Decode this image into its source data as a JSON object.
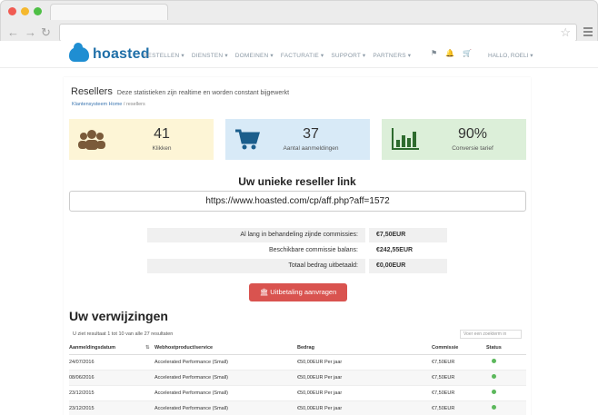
{
  "browser": {
    "back_icon": "arrow-left-icon",
    "forward_icon": "arrow-right-icon",
    "reload_icon": "reload-icon"
  },
  "site": {
    "logo_text": "hoasted",
    "menu": [
      "BESTELLEN ▾",
      "DIENSTEN ▾",
      "DOMEINEN ▾",
      "FACTURATIE ▾",
      "SUPPORT ▾",
      "PARTNERS ▾"
    ],
    "user": "HALLO, ROELI ▾"
  },
  "page": {
    "title": "Resellers",
    "subtitle": "Deze statistieken zijn realtime en worden constant bijgewerkt",
    "breadcrumb_home": "Klantensysteem Home",
    "breadcrumb_sep": "/",
    "breadcrumb_current": "resellers"
  },
  "stats": [
    {
      "value": "41",
      "label": "Klikken",
      "bg": "#fdf5d6",
      "icon": "users-icon"
    },
    {
      "value": "37",
      "label": "Aantal aanmeldingen",
      "bg": "#d8eaf7",
      "icon": "cart-icon"
    },
    {
      "value": "90%",
      "label": "Conversie tarief",
      "bg": "#dcefd9",
      "icon": "bar-chart-icon"
    }
  ],
  "link": {
    "title": "Uw unieke reseller link",
    "url": "https://www.hoasted.com/cp/aff.php?aff=1572"
  },
  "commissions": [
    {
      "label": "Al lang in behandeling zijnde commissies:",
      "value": "€7,50EUR"
    },
    {
      "label": "Beschikbare commissie balans:",
      "value": "€242,55EUR"
    },
    {
      "label": "Totaal bedrag uitbetaald:",
      "value": "€0,00EUR"
    }
  ],
  "payout_button": "🏛 Uitbetaling aanvragen",
  "referrals": {
    "title": "Uw verwijzingen",
    "results": "U ziet resultaat 1 tot 10 van alle 27 resultaten",
    "search_placeholder": "Voer een zoekterm in",
    "columns": [
      "Aanmeldingsdatum",
      "Webhostproduct/service",
      "Bedrag",
      "Commissie",
      "Status"
    ],
    "rows": [
      {
        "date": "24/07/2016",
        "product": "Accelerated Performance (Small)",
        "amount": "€50,00EUR Per jaar",
        "commission": "€7,50EUR"
      },
      {
        "date": "08/06/2016",
        "product": "Accelerated Performance (Small)",
        "amount": "€50,00EUR Per jaar",
        "commission": "€7,50EUR"
      },
      {
        "date": "23/12/2015",
        "product": "Accelerated Performance (Small)",
        "amount": "€50,00EUR Per jaar",
        "commission": "€7,50EUR"
      },
      {
        "date": "23/12/2015",
        "product": "Accelerated Performance (Small)",
        "amount": "€50,00EUR Per jaar",
        "commission": "€7,50EUR"
      }
    ],
    "status_color": "#5cb85c"
  }
}
